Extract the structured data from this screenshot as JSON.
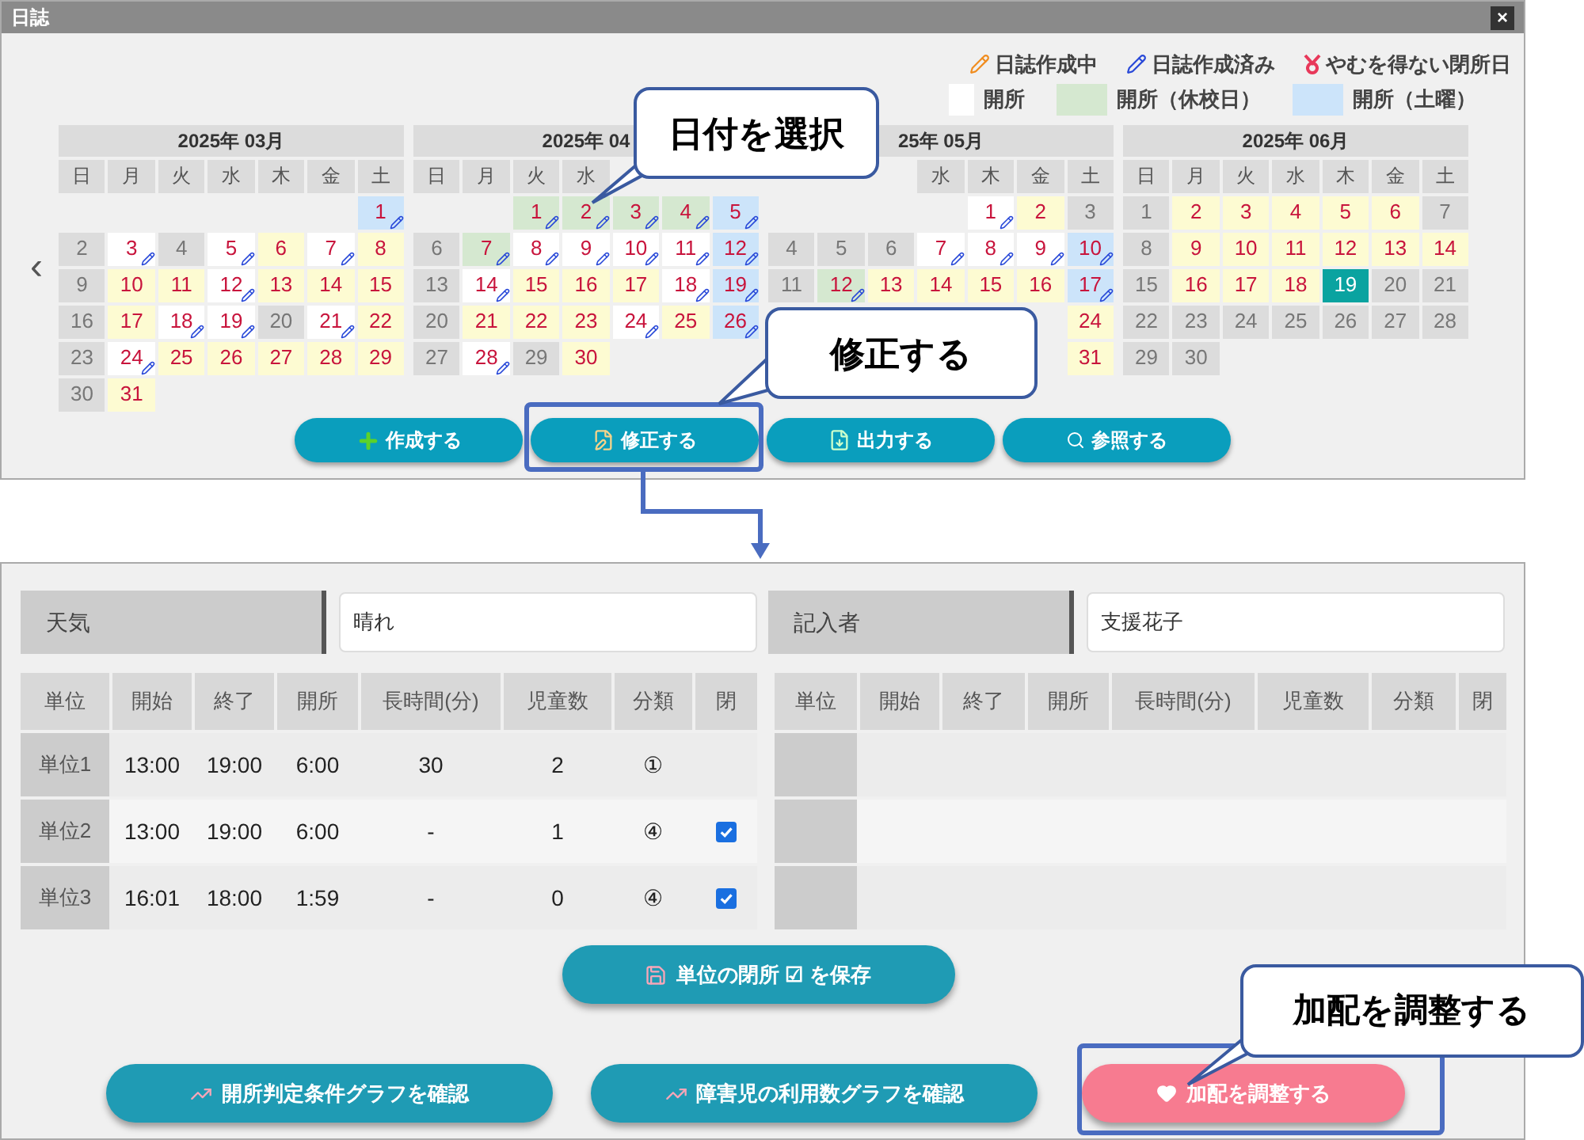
{
  "window": {
    "title": "日誌",
    "close": "×"
  },
  "legend": {
    "icons": [
      {
        "kind": "in_progress",
        "label": "日誌作成中"
      },
      {
        "kind": "done",
        "label": "日誌作成済み"
      },
      {
        "kind": "forced_closed",
        "label": "やむを得ない閉所日"
      }
    ],
    "swatches": [
      {
        "label": "開所",
        "color": "#ffffff"
      },
      {
        "label": "開所（休校日）",
        "color": "#d5e8d0"
      },
      {
        "label": "開所（土曜）",
        "color": "#cce4fa"
      }
    ]
  },
  "calendar": {
    "prev": "‹",
    "months": [
      {
        "title": "2025年 03月",
        "weekdays": [
          {
            "label": "日"
          },
          {
            "label": "月"
          },
          {
            "label": "火"
          },
          {
            "label": "水"
          },
          {
            "label": "木"
          },
          {
            "label": "金"
          },
          {
            "label": "土"
          }
        ],
        "weeks": [
          [
            {
              "kind": "blank"
            },
            {
              "kind": "blank"
            },
            {
              "kind": "blank"
            },
            {
              "kind": "blank"
            },
            {
              "kind": "blank"
            },
            {
              "kind": "blank"
            },
            {
              "d": "1",
              "kind": "saturday",
              "done": true
            }
          ],
          [
            {
              "d": "2",
              "kind": "closed",
              "done": false
            },
            {
              "d": "3",
              "kind": "open",
              "done": true
            },
            {
              "d": "4",
              "kind": "closed",
              "done": false
            },
            {
              "d": "5",
              "kind": "open",
              "done": true
            },
            {
              "d": "6",
              "kind": "pending",
              "done": false
            },
            {
              "d": "7",
              "kind": "open",
              "done": true
            },
            {
              "d": "8",
              "kind": "pending",
              "done": false
            }
          ],
          [
            {
              "d": "9",
              "kind": "closed",
              "done": false
            },
            {
              "d": "10",
              "kind": "pending",
              "done": false
            },
            {
              "d": "11",
              "kind": "pending",
              "done": false
            },
            {
              "d": "12",
              "kind": "open",
              "done": true
            },
            {
              "d": "13",
              "kind": "pending",
              "done": false
            },
            {
              "d": "14",
              "kind": "pending",
              "done": false
            },
            {
              "d": "15",
              "kind": "pending",
              "done": false
            }
          ],
          [
            {
              "d": "16",
              "kind": "closed",
              "done": false
            },
            {
              "d": "17",
              "kind": "pending",
              "done": false
            },
            {
              "d": "18",
              "kind": "open",
              "done": true
            },
            {
              "d": "19",
              "kind": "open",
              "done": true
            },
            {
              "d": "20",
              "kind": "closed",
              "done": false
            },
            {
              "d": "21",
              "kind": "open",
              "done": true
            },
            {
              "d": "22",
              "kind": "pending",
              "done": false
            }
          ],
          [
            {
              "d": "23",
              "kind": "closed",
              "done": false
            },
            {
              "d": "24",
              "kind": "open",
              "done": true
            },
            {
              "d": "25",
              "kind": "pending",
              "done": false
            },
            {
              "d": "26",
              "kind": "pending",
              "done": false
            },
            {
              "d": "27",
              "kind": "pending",
              "done": false
            },
            {
              "d": "28",
              "kind": "pending",
              "done": false
            },
            {
              "d": "29",
              "kind": "pending",
              "done": false
            }
          ],
          [
            {
              "d": "30",
              "kind": "closed",
              "done": false
            },
            {
              "d": "31",
              "kind": "pending",
              "done": false
            }
          ]
        ]
      },
      {
        "title": "2025年 04",
        "weekdays": [
          {
            "label": "日"
          },
          {
            "label": "月"
          },
          {
            "label": "火"
          },
          {
            "label": "水"
          },
          {
            "kind": "blank"
          },
          {
            "kind": "blank"
          },
          {
            "kind": "blank"
          }
        ],
        "weeks": [
          [
            {
              "kind": "blank"
            },
            {
              "kind": "blank"
            },
            {
              "d": "1",
              "kind": "school_holiday",
              "done": true
            },
            {
              "d": "2",
              "kind": "school_holiday",
              "done": true
            },
            {
              "d": "3",
              "kind": "school_holiday",
              "done": true
            },
            {
              "d": "4",
              "kind": "school_holiday",
              "done": true
            },
            {
              "d": "5",
              "kind": "saturday",
              "done": true
            }
          ],
          [
            {
              "d": "6",
              "kind": "closed",
              "done": false
            },
            {
              "d": "7",
              "kind": "school_holiday",
              "done": true
            },
            {
              "d": "8",
              "kind": "open",
              "done": true
            },
            {
              "d": "9",
              "kind": "open",
              "done": true
            },
            {
              "d": "10",
              "kind": "open",
              "done": true
            },
            {
              "d": "11",
              "kind": "open",
              "done": true
            },
            {
              "d": "12",
              "kind": "saturday",
              "done": true
            }
          ],
          [
            {
              "d": "13",
              "kind": "closed",
              "done": false
            },
            {
              "d": "14",
              "kind": "open",
              "done": true
            },
            {
              "d": "15",
              "kind": "pending",
              "done": false
            },
            {
              "d": "16",
              "kind": "pending",
              "done": false
            },
            {
              "d": "17",
              "kind": "pending",
              "done": false
            },
            {
              "d": "18",
              "kind": "open",
              "done": true
            },
            {
              "d": "19",
              "kind": "saturday",
              "done": true
            }
          ],
          [
            {
              "d": "20",
              "kind": "closed",
              "done": false
            },
            {
              "d": "21",
              "kind": "pending",
              "done": false
            },
            {
              "d": "22",
              "kind": "pending",
              "done": false
            },
            {
              "d": "23",
              "kind": "pending",
              "done": false
            },
            {
              "d": "24",
              "kind": "open",
              "done": true
            },
            {
              "d": "25",
              "kind": "pending",
              "done": false
            },
            {
              "d": "26",
              "kind": "saturday",
              "done": true
            }
          ],
          [
            {
              "d": "27",
              "kind": "closed",
              "done": false
            },
            {
              "d": "28",
              "kind": "open",
              "done": true
            },
            {
              "d": "29",
              "kind": "closed",
              "done": false
            },
            {
              "d": "30",
              "kind": "pending",
              "done": false
            }
          ]
        ]
      },
      {
        "title": "25年 05月",
        "weekdays": [
          {
            "kind": "blank"
          },
          {
            "kind": "blank"
          },
          {
            "kind": "blank"
          },
          {
            "label": "水"
          },
          {
            "label": "木"
          },
          {
            "label": "金"
          },
          {
            "label": "土"
          }
        ],
        "weeks": [
          [
            {
              "kind": "blank"
            },
            {
              "kind": "blank"
            },
            {
              "kind": "blank"
            },
            {
              "kind": "blank"
            },
            {
              "d": "1",
              "kind": "open",
              "done": true
            },
            {
              "d": "2",
              "kind": "pending",
              "done": false
            },
            {
              "d": "3",
              "kind": "closed",
              "done": false
            }
          ],
          [
            {
              "d": "4",
              "kind": "closed",
              "done": false
            },
            {
              "d": "5",
              "kind": "closed",
              "done": false
            },
            {
              "d": "6",
              "kind": "closed",
              "done": false
            },
            {
              "d": "7",
              "kind": "open",
              "done": true
            },
            {
              "d": "8",
              "kind": "open",
              "done": true
            },
            {
              "d": "9",
              "kind": "open",
              "done": true
            },
            {
              "d": "10",
              "kind": "saturday",
              "done": true
            }
          ],
          [
            {
              "d": "11",
              "kind": "closed",
              "done": false
            },
            {
              "d": "12",
              "kind": "school_holiday",
              "done": true
            },
            {
              "d": "13",
              "kind": "pending",
              "done": false
            },
            {
              "d": "14",
              "kind": "pending",
              "done": false
            },
            {
              "d": "15",
              "kind": "pending",
              "done": false
            },
            {
              "d": "16",
              "kind": "pending",
              "done": false
            },
            {
              "d": "17",
              "kind": "saturday",
              "done": true
            }
          ],
          [
            {
              "kind": "blank"
            },
            {
              "kind": "blank"
            },
            {
              "kind": "blank"
            },
            {
              "kind": "blank"
            },
            {
              "kind": "blank"
            },
            {
              "kind": "blank"
            },
            {
              "d": "24",
              "kind": "pending",
              "done": false
            }
          ],
          [
            {
              "kind": "blank"
            },
            {
              "kind": "blank"
            },
            {
              "kind": "blank"
            },
            {
              "kind": "blank"
            },
            {
              "kind": "blank"
            },
            {
              "kind": "blank"
            },
            {
              "d": "31",
              "kind": "pending",
              "done": false
            }
          ]
        ]
      },
      {
        "title": "2025年 06月",
        "weekdays": [
          {
            "label": "日"
          },
          {
            "label": "月"
          },
          {
            "label": "火"
          },
          {
            "label": "水"
          },
          {
            "label": "木"
          },
          {
            "label": "金"
          },
          {
            "label": "土"
          }
        ],
        "weeks": [
          [
            {
              "d": "1",
              "kind": "closed",
              "done": false
            },
            {
              "d": "2",
              "kind": "pending",
              "done": false
            },
            {
              "d": "3",
              "kind": "pending",
              "done": false
            },
            {
              "d": "4",
              "kind": "pending",
              "done": false
            },
            {
              "d": "5",
              "kind": "pending",
              "done": false
            },
            {
              "d": "6",
              "kind": "pending",
              "done": false
            },
            {
              "d": "7",
              "kind": "closed",
              "done": false
            }
          ],
          [
            {
              "d": "8",
              "kind": "closed",
              "done": false
            },
            {
              "d": "9",
              "kind": "pending",
              "done": false
            },
            {
              "d": "10",
              "kind": "pending",
              "done": false
            },
            {
              "d": "11",
              "kind": "pending",
              "done": false
            },
            {
              "d": "12",
              "kind": "pending",
              "done": false
            },
            {
              "d": "13",
              "kind": "pending",
              "done": false
            },
            {
              "d": "14",
              "kind": "pending",
              "done": false
            }
          ],
          [
            {
              "d": "15",
              "kind": "closed",
              "done": false
            },
            {
              "d": "16",
              "kind": "pending",
              "done": false
            },
            {
              "d": "17",
              "kind": "pending",
              "done": false
            },
            {
              "d": "18",
              "kind": "pending",
              "done": false
            },
            {
              "d": "19",
              "kind": "today",
              "done": false
            },
            {
              "d": "20",
              "kind": "closed",
              "done": false
            },
            {
              "d": "21",
              "kind": "closed",
              "done": false
            }
          ],
          [
            {
              "d": "22",
              "kind": "closed",
              "done": false
            },
            {
              "d": "23",
              "kind": "closed",
              "done": false
            },
            {
              "d": "24",
              "kind": "closed",
              "done": false
            },
            {
              "d": "25",
              "kind": "closed",
              "done": false
            },
            {
              "d": "26",
              "kind": "closed",
              "done": false
            },
            {
              "d": "27",
              "kind": "closed",
              "done": false
            },
            {
              "d": "28",
              "kind": "closed",
              "done": false
            }
          ],
          [
            {
              "d": "29",
              "kind": "closed",
              "done": false
            },
            {
              "d": "30",
              "kind": "closed",
              "done": false
            }
          ]
        ]
      }
    ]
  },
  "actions": [
    {
      "kind": "create",
      "label": "作成する"
    },
    {
      "kind": "edit",
      "label": "修正する"
    },
    {
      "kind": "export",
      "label": "出力する"
    },
    {
      "kind": "view",
      "label": "参照する"
    }
  ],
  "detail": {
    "fields": [
      {
        "label": "天気",
        "value": "晴れ"
      },
      {
        "label": "記入者",
        "value": "支援花子"
      }
    ],
    "left_table": {
      "columns": [
        "単位",
        "開始",
        "終了",
        "開所",
        "長時間(分)",
        "児童数",
        "分類",
        "閉"
      ],
      "rows": [
        {
          "cells": [
            "単位1",
            "13:00",
            "19:00",
            "6:00",
            "30",
            "2",
            "①"
          ],
          "closed": false
        },
        {
          "cells": [
            "単位2",
            "13:00",
            "19:00",
            "6:00",
            "-",
            "1",
            "④"
          ],
          "closed": true
        },
        {
          "cells": [
            "単位3",
            "16:01",
            "18:00",
            "1:59",
            "-",
            "0",
            "④"
          ],
          "closed": true
        }
      ]
    },
    "right_table": {
      "columns": [
        "単位",
        "開始",
        "終了",
        "開所",
        "長時間(分)",
        "児童数",
        "分類",
        "閉"
      ]
    },
    "save_button": "単位の閉所 ☑ を保存",
    "bottom_buttons": [
      {
        "kind": "chart",
        "label": "開所判定条件グラフを確認"
      },
      {
        "kind": "chart",
        "label": "障害児の利用数グラフを確認"
      },
      {
        "kind": "staffing",
        "label": "加配を調整する"
      }
    ]
  },
  "callouts": [
    "日付を選択",
    "修正する",
    "加配を調整する"
  ]
}
